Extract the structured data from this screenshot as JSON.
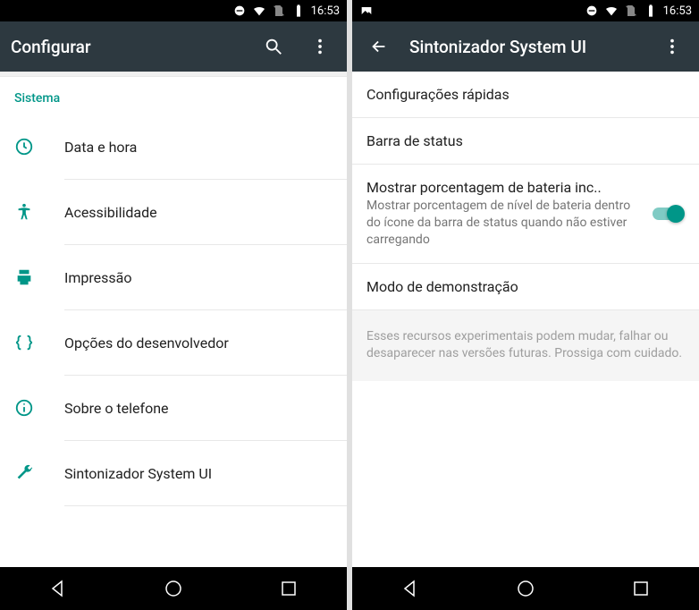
{
  "status": {
    "time": "16:53"
  },
  "left": {
    "header": {
      "title": "Configurar"
    },
    "section": "Sistema",
    "items": [
      {
        "id": "date-time",
        "label": "Data e hora"
      },
      {
        "id": "accessibility",
        "label": "Acessibilidade"
      },
      {
        "id": "printing",
        "label": "Impressão"
      },
      {
        "id": "developer",
        "label": "Opções do desenvolvedor"
      },
      {
        "id": "about",
        "label": "Sobre o telefone"
      },
      {
        "id": "system-ui-tuner",
        "label": "Sintonizador System UI"
      }
    ]
  },
  "right": {
    "header": {
      "title": "Sintonizador System UI"
    },
    "rows": {
      "quick_settings": "Configurações rápidas",
      "status_bar": "Barra de status",
      "battery_pct_title": "Mostrar porcentagem de bateria inc..",
      "battery_pct_subtitle": "Mostrar porcentagem de nível de bateria dentro do ícone da barra de status quando não estiver carregando",
      "demo_mode": "Modo de demonstração"
    },
    "footnote": "Esses recursos experimentais podem mudar, falhar ou desaparecer nas versões futuras. Prossiga com cuidado."
  }
}
